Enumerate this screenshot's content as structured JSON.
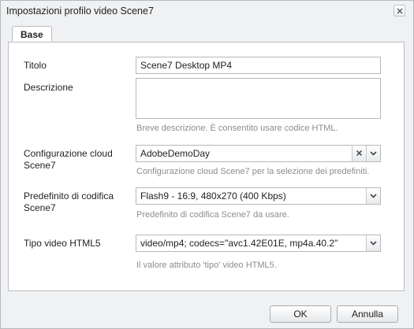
{
  "dialog": {
    "title": "Impostazioni profilo video Scene7"
  },
  "tabs": [
    {
      "label": "Base",
      "active": true
    }
  ],
  "form": {
    "title": {
      "label": "Titolo",
      "value": "Scene7 Desktop MP4"
    },
    "description": {
      "label": "Descrizione",
      "value": "",
      "hint": "Breve descrizione. È consentito usare codice HTML."
    },
    "cloud_config": {
      "label_line1": "Configurazione cloud",
      "label_line2": "Scene7",
      "value": "AdobeDemoDay",
      "hint": "Configurazione cloud Scene7 per la selezione dei predefiniti."
    },
    "encoding_preset": {
      "label_line1": "Predefinito di codifica",
      "label_line2": "Scene7",
      "value": "Flash9 - 16:9, 480x270 (400 Kbps)",
      "hint": "Predefinito di codifica Scene7 da usare."
    },
    "html5_type": {
      "label": "Tipo video HTML5",
      "value": "video/mp4; codecs=\"avc1.42E01E, mp4a.40.2\"",
      "hint": "Il valore attributo 'tipo' video HTML5."
    }
  },
  "footer": {
    "ok_label": "OK",
    "cancel_label": "Annulla"
  },
  "icons": {
    "close": "close-icon",
    "clear": "clear-icon",
    "dropdown": "chevron-down-icon"
  }
}
